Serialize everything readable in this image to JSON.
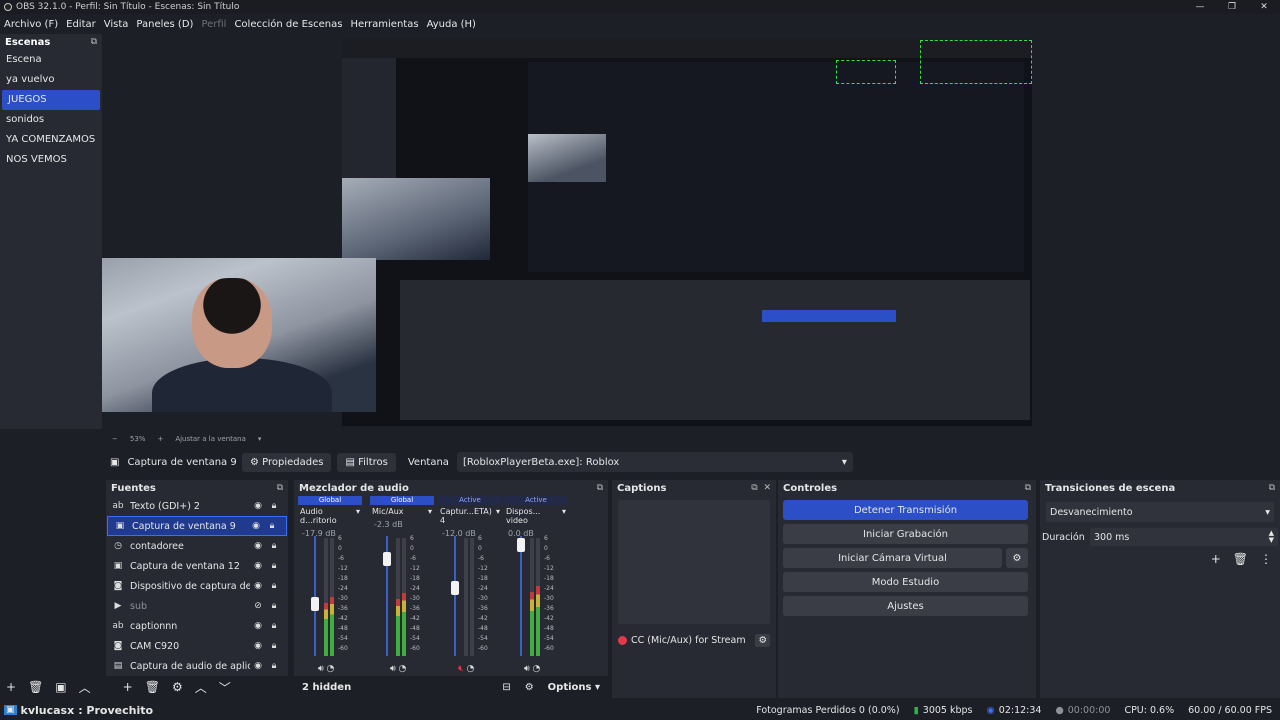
{
  "window": {
    "title": "OBS 32.1.0 - Perfil: Sin Título - Escenas: Sin Título",
    "controls": [
      "—",
      "❐",
      "✕"
    ]
  },
  "menu": [
    "Archivo (F)",
    "Editar",
    "Vista",
    "Paneles (D)",
    "Perfil",
    "Colección de Escenas",
    "Herramientas",
    "Ayuda (H)"
  ],
  "scenes": {
    "title": "Escenas",
    "items": [
      "Escena",
      "ya vuelvo",
      "JUEGOS",
      "sonidos",
      "YA COMENZAMOS",
      "NOS VEMOS"
    ],
    "active_index": 2
  },
  "preview": {
    "zoom": "53%",
    "fit_label": "Ajustar a la ventana"
  },
  "source_toolbar": {
    "source_name": "Captura de ventana 9",
    "properties": "Propiedades",
    "filters": "Filtros",
    "window_label": "Ventana",
    "window_value": "[RobloxPlayerBeta.exe]: Roblox"
  },
  "sources": {
    "title": "Fuentes",
    "items": [
      {
        "name": "Texto (GDI+) 2",
        "icon": "text-icon"
      },
      {
        "name": "Captura de ventana 9",
        "icon": "window-icon"
      },
      {
        "name": "contadoree",
        "icon": "clock-icon"
      },
      {
        "name": "Captura de ventana 12",
        "icon": "window-icon"
      },
      {
        "name": "Dispositivo de captura de vide",
        "icon": "camera-icon"
      },
      {
        "name": "sub",
        "icon": "play-icon"
      },
      {
        "name": "captionnn",
        "icon": "text-icon"
      },
      {
        "name": "CAM C920",
        "icon": "camera-icon"
      },
      {
        "name": "Captura de audio de aplicació",
        "icon": "app-audio-icon"
      }
    ],
    "active_index": 1
  },
  "mixer": {
    "title": "Mezclador de audio",
    "channels": [
      {
        "tag": "Global",
        "name": "Audio d...ritorio",
        "db": "-17.9 dB",
        "level": 0.42
      },
      {
        "tag": "Global",
        "name": "Mic/Aux",
        "db": "-2.3 dB",
        "level": 0.85
      },
      {
        "tag": "Active",
        "name": "Captur...ETA) 4",
        "db": "-12.0 dB",
        "level": 0.58
      },
      {
        "tag": "Active",
        "name": "Dispos... video",
        "db": "0.0 dB",
        "level": 0.98
      }
    ],
    "ticks": [
      "6",
      "0",
      "-6",
      "-12",
      "-18",
      "-24",
      "-30",
      "-36",
      "-42",
      "-48",
      "-54",
      "-60"
    ],
    "hidden": "2 hidden",
    "options": "Options"
  },
  "captions": {
    "title": "Captions",
    "source": "CC (Mic/Aux) for Stream"
  },
  "controls": {
    "title": "Controles",
    "stop_stream": "Detener Transmisión",
    "start_record": "Iniciar Grabación",
    "start_vcam": "Iniciar Cámara Virtual",
    "studio_mode": "Modo Estudio",
    "settings": "Ajustes"
  },
  "transitions": {
    "title": "Transiciones de escena",
    "selected": "Desvanecimiento",
    "duration_label": "Duración",
    "duration_value": "300 ms"
  },
  "status": {
    "channel": "kvlucasx",
    "title_text": ": Provechito",
    "dropped": "Fotogramas Perdidos 0 (0.0%)",
    "bitrate": "3005 kbps",
    "stream_time": "02:12:34",
    "rec_time": "00:00:00",
    "cpu": "CPU: 0.6%",
    "fps": "60.00 / 60.00 FPS"
  },
  "colors": {
    "accent": "#2c4fc7",
    "bg": "#1d1f26",
    "panel": "#272a33"
  }
}
